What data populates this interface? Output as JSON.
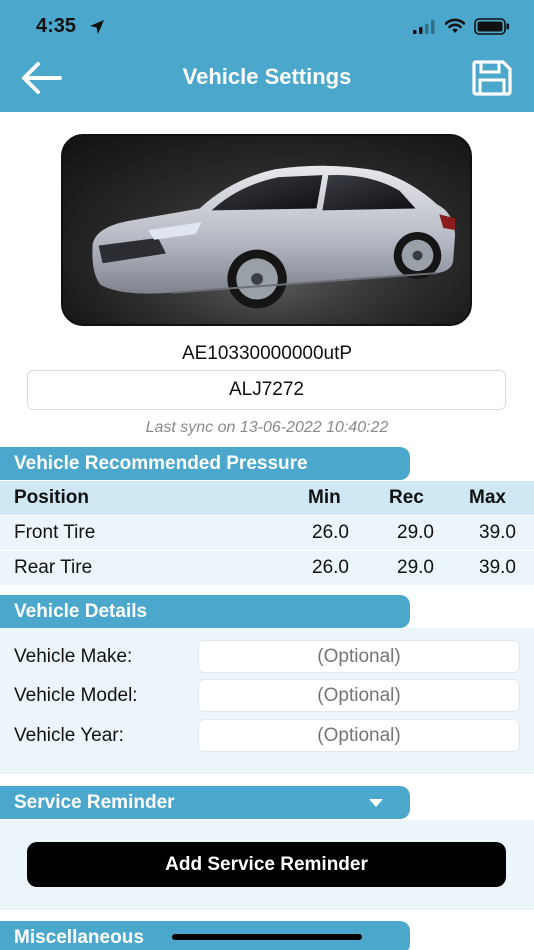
{
  "status_bar": {
    "time": "4:35",
    "icons": [
      "location-arrow-icon",
      "cellular-signal-icon",
      "wifi-icon",
      "battery-icon"
    ]
  },
  "header": {
    "title": "Vehicle Settings",
    "back_icon": "back-arrow-icon",
    "save_icon": "floppy-save-icon",
    "color": "#4ba8cc"
  },
  "vehicle": {
    "device_id": "AE10330000000utP",
    "plate": "ALJ7272",
    "last_sync": "Last sync on 13-06-2022 10:40:22"
  },
  "pressure": {
    "section_title": "Vehicle Recommended Pressure",
    "columns": [
      "Position",
      "Min",
      "Rec",
      "Max"
    ],
    "rows": [
      {
        "position": "Front Tire",
        "min": "26.0",
        "rec": "29.0",
        "max": "39.0"
      },
      {
        "position": "Rear Tire",
        "min": "26.0",
        "rec": "29.0",
        "max": "39.0"
      }
    ]
  },
  "details": {
    "section_title": "Vehicle Details",
    "fields": [
      {
        "label": "Vehicle Make:",
        "placeholder": "(Optional)",
        "value": ""
      },
      {
        "label": "Vehicle Model:",
        "placeholder": "(Optional)",
        "value": ""
      },
      {
        "label": "Vehicle Year:",
        "placeholder": "(Optional)",
        "value": ""
      }
    ]
  },
  "service": {
    "section_title": "Service Reminder",
    "toggle_icon": "caret-down-icon",
    "add_button": "Add Service Reminder"
  },
  "misc": {
    "section_title": "Miscellaneous"
  }
}
